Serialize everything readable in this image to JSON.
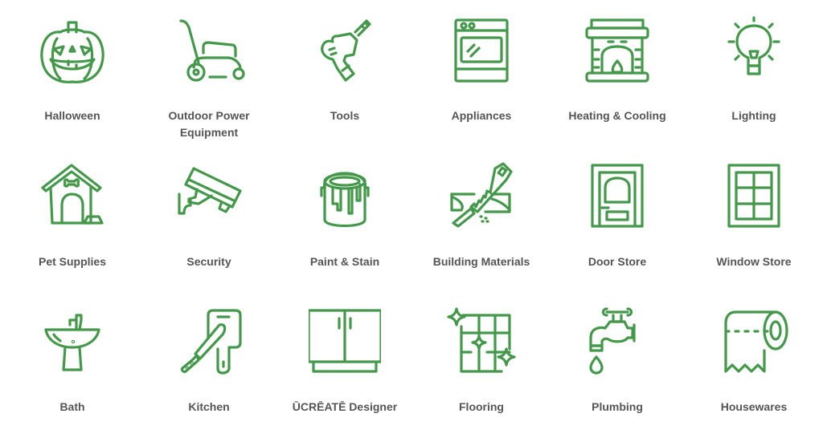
{
  "accent_color": "#43984a",
  "text_color": "#555555",
  "categories": [
    {
      "label": "Halloween",
      "icon": "pumpkin-icon"
    },
    {
      "label": "Outdoor Power Equipment",
      "icon": "lawn-mower-icon"
    },
    {
      "label": "Tools",
      "icon": "drill-icon"
    },
    {
      "label": "Appliances",
      "icon": "oven-icon"
    },
    {
      "label": "Heating & Cooling",
      "icon": "fireplace-icon"
    },
    {
      "label": "Lighting",
      "icon": "light-bulb-icon"
    },
    {
      "label": "Pet Supplies",
      "icon": "dog-house-icon"
    },
    {
      "label": "Security",
      "icon": "security-camera-icon"
    },
    {
      "label": "Paint & Stain",
      "icon": "paint-can-icon"
    },
    {
      "label": "Building Materials",
      "icon": "saw-icon"
    },
    {
      "label": "Door Store",
      "icon": "door-icon"
    },
    {
      "label": "Window Store",
      "icon": "window-icon"
    },
    {
      "label": "Bath",
      "icon": "sink-icon"
    },
    {
      "label": "Kitchen",
      "icon": "knife-board-icon"
    },
    {
      "label": "ŪCRĒATĒ Designer",
      "icon": "cabinet-icon"
    },
    {
      "label": "Flooring",
      "icon": "tiles-icon"
    },
    {
      "label": "Plumbing",
      "icon": "faucet-icon"
    },
    {
      "label": "Housewares",
      "icon": "paper-roll-icon"
    }
  ]
}
